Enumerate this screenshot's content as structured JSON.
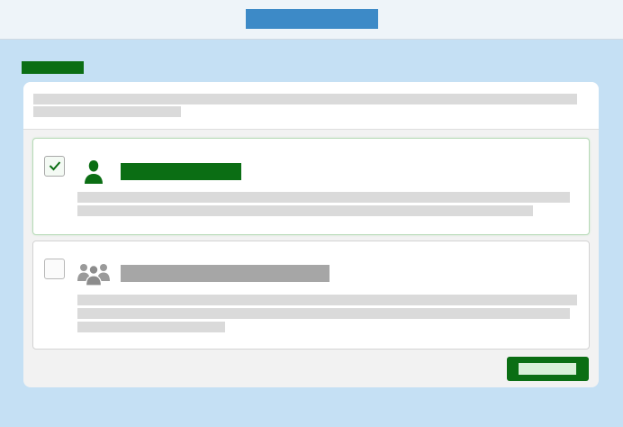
{
  "header": {
    "title": ""
  },
  "page": {
    "label": ""
  },
  "panel": {
    "intro_text": ""
  },
  "options": [
    {
      "title": "",
      "description": "",
      "selected": true,
      "icon": "person-icon"
    },
    {
      "title": "",
      "description": "",
      "selected": false,
      "icon": "group-icon"
    }
  ],
  "actions": {
    "continue_label": ""
  },
  "colors": {
    "brand_green": "#0b6e14",
    "header_accent": "#3d8ac7",
    "background": "#c5e0f4",
    "placeholder": "#dadada"
  }
}
